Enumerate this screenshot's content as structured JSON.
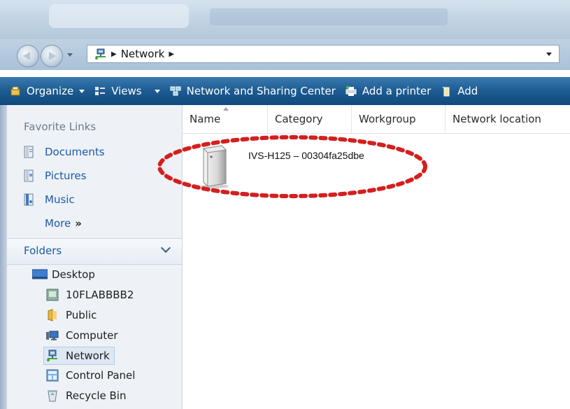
{
  "window": {
    "address": {
      "segments": [
        "Network"
      ],
      "icon": "network-icon"
    }
  },
  "toolbar": {
    "organize_label": "Organize",
    "views_label": "Views",
    "network_sharing_label": "Network and Sharing Center",
    "add_printer_label": "Add a printer",
    "add_wireless_label": "Add"
  },
  "sidebar": {
    "favorite_links_title": "Favorite Links",
    "favorites": [
      {
        "label": "Documents",
        "icon": "documents-icon"
      },
      {
        "label": "Pictures",
        "icon": "pictures-icon"
      },
      {
        "label": "Music",
        "icon": "music-icon"
      }
    ],
    "more_label": "More",
    "folders_label": "Folders",
    "tree": [
      {
        "label": "Desktop",
        "icon": "desktop-icon"
      },
      {
        "label": "10FLABBBB2",
        "icon": "user-icon"
      },
      {
        "label": "Public",
        "icon": "folder-icon"
      },
      {
        "label": "Computer",
        "icon": "computer-icon"
      },
      {
        "label": "Network",
        "icon": "network-icon",
        "selected": true
      },
      {
        "label": "Control Panel",
        "icon": "control-panel-icon"
      },
      {
        "label": "Recycle Bin",
        "icon": "recycle-bin-icon"
      }
    ]
  },
  "content": {
    "columns": [
      "Name",
      "Category",
      "Workgroup",
      "Network location"
    ],
    "items": [
      {
        "label": "IVS-H125 – 00304fa25dbe",
        "icon": "network-device-icon"
      }
    ]
  },
  "colors": {
    "command_bar": "#1d5b91",
    "link": "#1b5aa6",
    "annotation": "#d41f1f"
  }
}
